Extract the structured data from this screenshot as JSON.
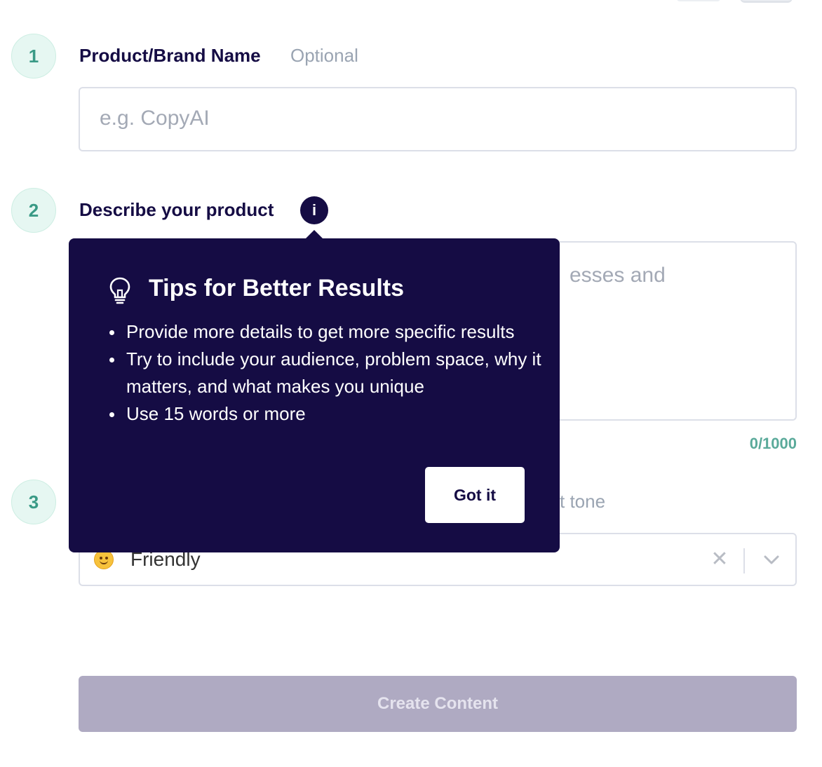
{
  "steps": {
    "one": {
      "number": "1",
      "label": "Product/Brand Name",
      "optional": "Optional",
      "placeholder": "e.g. CopyAI"
    },
    "two": {
      "number": "2",
      "label": "Describe your product",
      "info_glyph": "i",
      "placeholder_visible_fragment": "esses and",
      "counter": "0/1000"
    },
    "three": {
      "number": "3",
      "label_visible_fragment": "t tone",
      "selected_value": "Friendly",
      "selected_icon": "smiling-face-emoji-icon",
      "clear_glyph": "✕"
    }
  },
  "tooltip": {
    "title": "Tips for Better Results",
    "icon": "lightbulb-icon",
    "tips": [
      "Provide more details to get more specific results",
      "Try to include your audience, problem space, why it matters, and what makes you unique",
      "Use 15 words or more"
    ],
    "dismiss_label": "Got it"
  },
  "actions": {
    "create_label": "Create Content"
  },
  "colors": {
    "navy": "#150c44",
    "teal": "#3a9a86",
    "teal_bg": "#e6f7f2",
    "button_disabled": "#afaac2"
  }
}
